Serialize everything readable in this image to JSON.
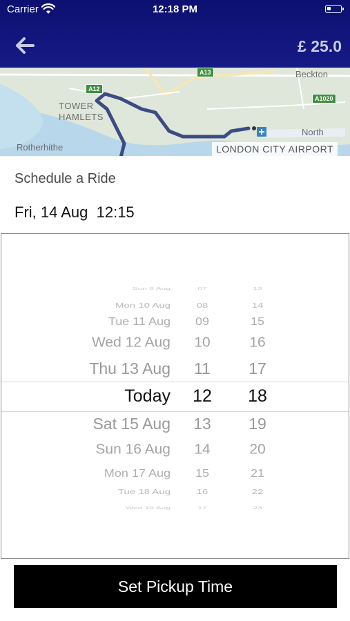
{
  "status_bar": {
    "carrier": "Carrier",
    "time": "12:18 PM",
    "icons": [
      "wifi-icon",
      "battery-icon"
    ]
  },
  "header": {
    "back_icon": "arrow-left-icon",
    "fare": "£ 25.0",
    "background": "#12157a"
  },
  "map": {
    "labels": [
      "TOWER HAMLETS",
      "Rotherhithe",
      "Beckton",
      "North",
      "LONDON CITY AIRPORT"
    ],
    "road_shields": [
      "A13",
      "A12",
      "A1020"
    ],
    "route_color": "#3c4b83"
  },
  "schedule": {
    "title": "Schedule a Ride",
    "selected": "Fri, 14 Aug  12:15"
  },
  "picker": {
    "rows": [
      {
        "date": "Sun 9 Aug",
        "hour": "07",
        "minute": "13"
      },
      {
        "date": "Mon 10 Aug",
        "hour": "08",
        "minute": "14"
      },
      {
        "date": "Tue 11 Aug",
        "hour": "09",
        "minute": "15"
      },
      {
        "date": "Wed 12 Aug",
        "hour": "10",
        "minute": "16"
      },
      {
        "date": "Thu 13 Aug",
        "hour": "11",
        "minute": "17"
      },
      {
        "date": "Today",
        "hour": "12",
        "minute": "18"
      },
      {
        "date": "Sat 15 Aug",
        "hour": "13",
        "minute": "19"
      },
      {
        "date": "Sun 16 Aug",
        "hour": "14",
        "minute": "20"
      },
      {
        "date": "Mon 17 Aug",
        "hour": "15",
        "minute": "21"
      },
      {
        "date": "Tue 18 Aug",
        "hour": "16",
        "minute": "22"
      },
      {
        "date": "Wed 19 Aug",
        "hour": "17",
        "minute": "23"
      }
    ],
    "selected_index": 5
  },
  "button": {
    "label": "Set Pickup Time"
  }
}
